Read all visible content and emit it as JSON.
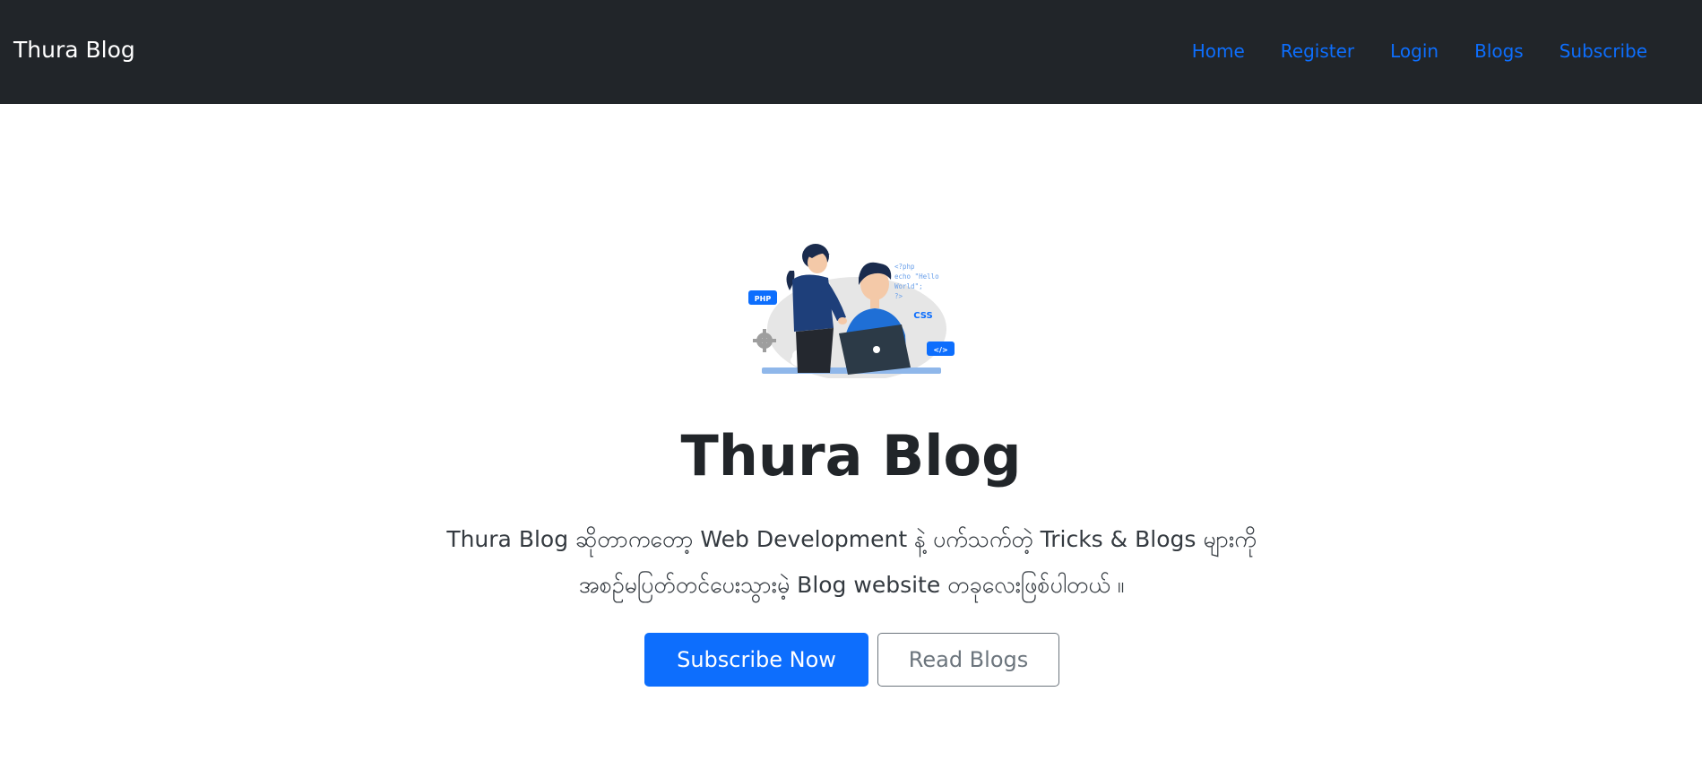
{
  "navbar": {
    "brand": "Thura Blog",
    "links": [
      {
        "label": "Home"
      },
      {
        "label": "Register"
      },
      {
        "label": "Login"
      },
      {
        "label": "Blogs"
      },
      {
        "label": "Subscribe"
      }
    ]
  },
  "hero": {
    "illustration": {
      "tags": [
        "PHP",
        "CSS",
        "</>"
      ],
      "code_lines": [
        "<?php",
        "echo \"Hello",
        "World\";",
        "?>"
      ]
    },
    "title": "Thura Blog",
    "description": "Thura Blog ဆိုတာကတော့ Web Development နဲ့ ပက်သက်တဲ့ Tricks & Blogs များကို အစဉ်မပြတ်တင်ပေးသွားမဲ့ Blog website တခုလေးဖြစ်ပါတယ် ။",
    "primary_button": "Subscribe Now",
    "secondary_button": "Read Blogs"
  },
  "colors": {
    "navbar_bg": "#212529",
    "link": "#0d6efd",
    "primary": "#0d6efd",
    "secondary": "#6c757d"
  }
}
